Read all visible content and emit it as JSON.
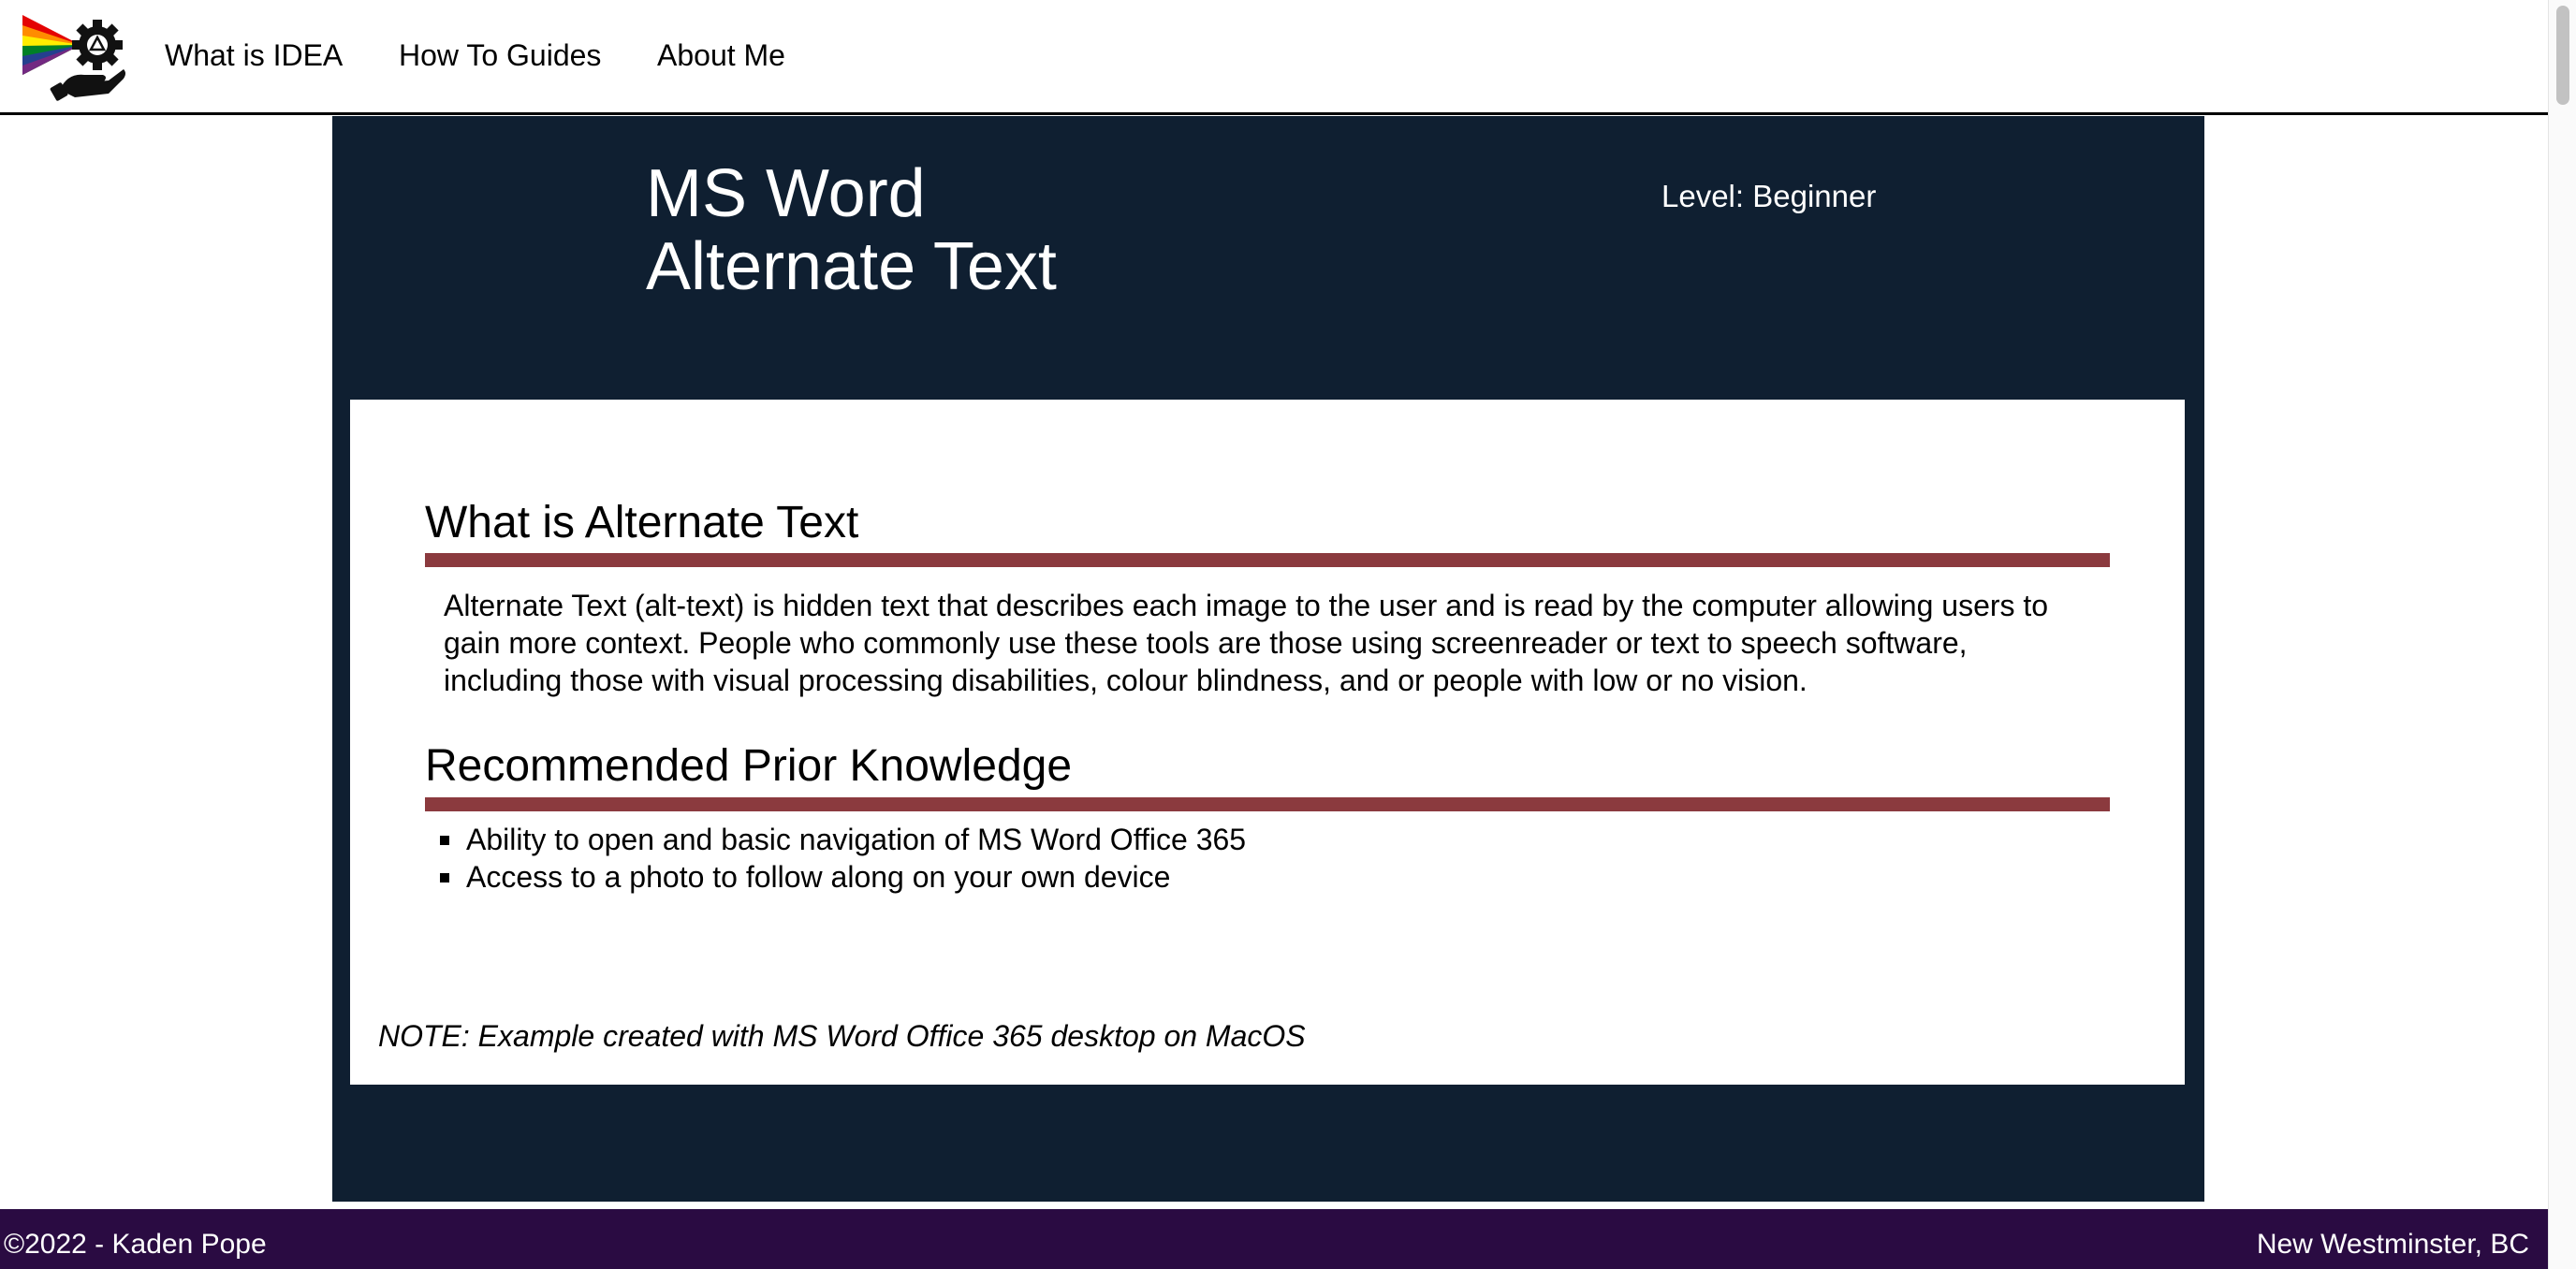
{
  "nav": {
    "items": [
      {
        "label": "What is IDEA"
      },
      {
        "label": "How To Guides"
      },
      {
        "label": "About Me"
      }
    ]
  },
  "hero": {
    "title_line1": "MS Word",
    "title_line2": "Alternate Text",
    "level": "Level: Beginner"
  },
  "content": {
    "section1_heading": "What is Alternate Text",
    "section1_text": "Alternate Text (alt-text) is hidden text that describes each image to the user and is read by the computer allowing users to gain more context. People who commonly use these tools are those using screenreader or text to speech software, including those with visual processing disabilities, colour blindness, and or people with low or no vision.",
    "section2_heading": "Recommended Prior Knowledge",
    "prior_knowledge": [
      "Ability to open and basic navigation of MS Word Office 365",
      "Access to a photo to follow along on your own device"
    ],
    "note": "NOTE: Example created with MS Word Office 365 desktop on MacOS"
  },
  "footer": {
    "copyright": "©2022 - Kaden Pope",
    "location": "New Westminster, BC"
  },
  "colors": {
    "hero_bg": "#0f1f31",
    "heading_bar": "#8b3a3e",
    "footer_bg": "#2a0b42"
  },
  "icons": {
    "logo": "rainbow-prism-gear-hand-logo",
    "list_marker": "square-bullet"
  }
}
